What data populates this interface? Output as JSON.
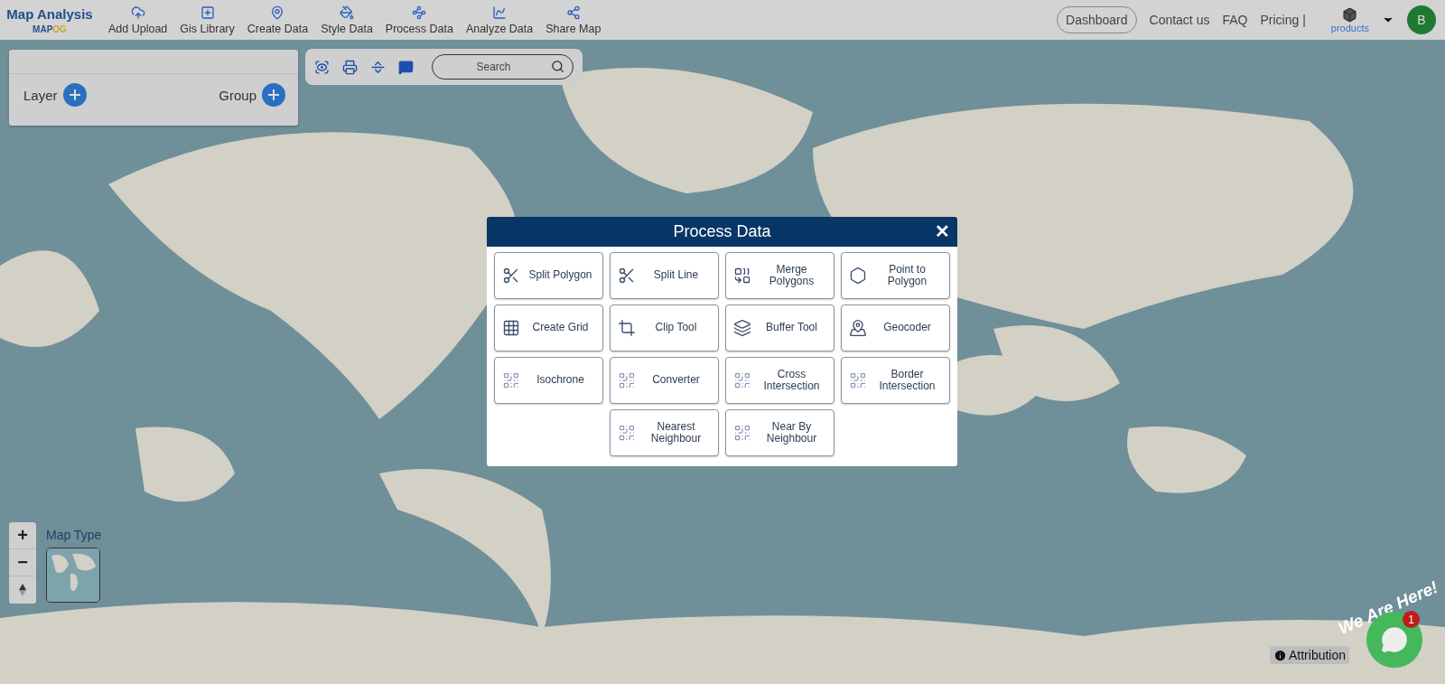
{
  "brand": {
    "title": "Map Analysis",
    "logo": "MAP",
    "logo_accent": "OG"
  },
  "nav": [
    {
      "label": "Add Upload"
    },
    {
      "label": "Gis Library"
    },
    {
      "label": "Create Data"
    },
    {
      "label": "Style Data"
    },
    {
      "label": "Process Data"
    },
    {
      "label": "Analyze Data"
    },
    {
      "label": "Share Map"
    }
  ],
  "header_right": {
    "dashboard": "Dashboard",
    "links": [
      "Contact us",
      "FAQ",
      "Pricing |"
    ],
    "products": "products",
    "avatar": "B"
  },
  "layer_panel": {
    "layer": "Layer",
    "group": "Group"
  },
  "map_toolbar": {
    "search": {
      "placeholder": "Search"
    }
  },
  "dialog": {
    "title": "Process Data",
    "close": "✕",
    "tools": [
      {
        "label": "Split Polygon"
      },
      {
        "label": "Split Line"
      },
      {
        "label": "Merge Polygons"
      },
      {
        "label": "Point to Polygon"
      },
      {
        "label": "Create Grid"
      },
      {
        "label": "Clip Tool"
      },
      {
        "label": "Buffer Tool"
      },
      {
        "label": "Geocoder"
      },
      {
        "label": "Isochrone"
      },
      {
        "label": "Converter"
      },
      {
        "label": "Cross Intersection"
      },
      {
        "label": "Border Intersection"
      },
      {
        "label": "Nearest Neighbour"
      },
      {
        "label": "Near By Neighbour"
      }
    ]
  },
  "map_controls": {
    "zoom_in": "+",
    "zoom_out": "−",
    "map_type": "Map Type"
  },
  "chat": {
    "tagline": "We Are Here!",
    "badge": "1"
  },
  "attribution": "Attribution"
}
